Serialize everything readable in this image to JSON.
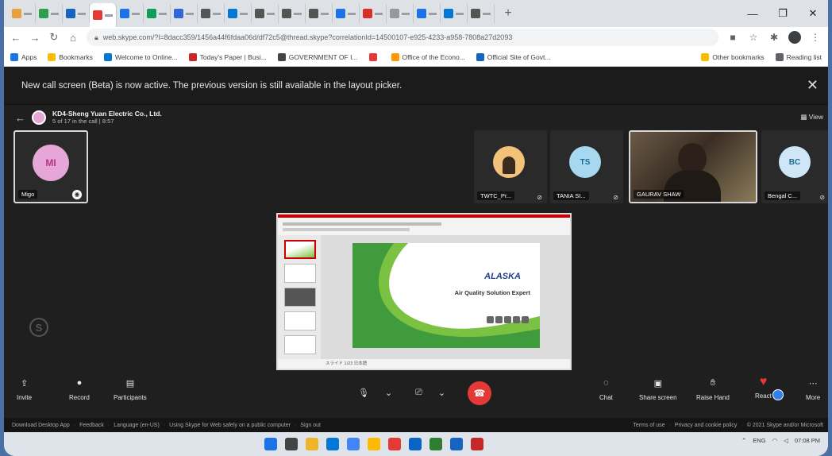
{
  "tabs": [
    {
      "color": "#e6a23c"
    },
    {
      "color": "#2e9e4f"
    },
    {
      "color": "#1565c0"
    },
    {
      "color": "#e53935",
      "active": true
    },
    {
      "color": "#1a73e8"
    },
    {
      "color": "#0f9d58"
    },
    {
      "color": "#3367d6"
    },
    {
      "color": "#555555"
    },
    {
      "color": "#0078d4"
    },
    {
      "color": "#555555"
    },
    {
      "color": "#555555"
    },
    {
      "color": "#555555"
    },
    {
      "color": "#1a73e8"
    },
    {
      "color": "#d93025"
    },
    {
      "color": "#999999"
    },
    {
      "color": "#1a73e8"
    },
    {
      "color": "#0078d4"
    },
    {
      "color": "#555555"
    }
  ],
  "browser": {
    "url": "web.skype.com/?l=8dacc359/1456a44f6fdaa06d/df72c5@thread.skype?correlationId=14500107-e925-4233-a958-7808a27d2093",
    "newtab": "+",
    "minimize": "—",
    "maximize": "❐",
    "close": "✕"
  },
  "bookmarks": {
    "left": [
      {
        "label": "Apps",
        "color": "#1a73e8"
      },
      {
        "label": "Bookmarks",
        "color": "#fbbc04"
      },
      {
        "label": "Welcome to Online...",
        "color": "#0078d4"
      },
      {
        "label": "Today's Paper | Busi...",
        "color": "#c62828"
      },
      {
        "label": "GOVERNMENT OF I...",
        "color": "#444444"
      },
      {
        "label": "",
        "color": "#e53935"
      },
      {
        "label": "Office of the Econo...",
        "color": "#ff9800"
      },
      {
        "label": "Official Site of Govt...",
        "color": "#1565c0"
      }
    ],
    "right": [
      "Other bookmarks",
      "Reading list"
    ]
  },
  "banner": {
    "text": "New call screen (Beta) is now active. The previous version is still available in the layout picker."
  },
  "call": {
    "name": "KD4-Sheng Yuan Electric Co., Ltd.",
    "subtitle": "5 of 17 in the call | 8:57",
    "view_label": "View"
  },
  "participants": [
    {
      "initials": "MI",
      "name": "Migo",
      "bg": "#e7a6d8",
      "fg": "#b0377c"
    },
    {
      "initials": "",
      "name": "TWTC_Pr...",
      "bg": "#f2c27b",
      "fg": "#333333"
    },
    {
      "initials": "TS",
      "name": "TANIA SI...",
      "bg": "#a8d8ef",
      "fg": "#1b6a93"
    },
    {
      "initials": "",
      "name": "GAURAV SHAW",
      "bg": "#5a4a3a",
      "fg": "#ffffff"
    },
    {
      "initials": "BC",
      "name": "Bengal C...",
      "bg": "#cfe6f6",
      "fg": "#1b6a93"
    }
  ],
  "slide": {
    "brand": "ALASKA",
    "title": "Air Quality Solution Expert",
    "status": "スライド 1/23  日本語"
  },
  "controls": {
    "invite": "Invite",
    "record": "Record",
    "participants": "Participants",
    "chat": "Chat",
    "share": "Share screen",
    "raise": "Raise Hand",
    "react": "React",
    "more": "More"
  },
  "footer": {
    "items": [
      "Download Desktop App",
      "Feedback",
      "Language (en-US)",
      "Using Skype for Web safely on a public computer",
      "Sign out"
    ],
    "right_items": [
      "Terms of use",
      "Privacy and cookie policy",
      "© 2021 Skype and/or Microsoft"
    ]
  },
  "taskbar": {
    "lang": "ENG",
    "time": "07:08 PM",
    "icons": [
      "#1a73e8",
      "#444444",
      "#f0b429",
      "#0078d4",
      "#4285f4",
      "#ffb900",
      "#e53935",
      "#0a64c8",
      "#2e7d32",
      "#1565c0",
      "#c62828"
    ]
  }
}
